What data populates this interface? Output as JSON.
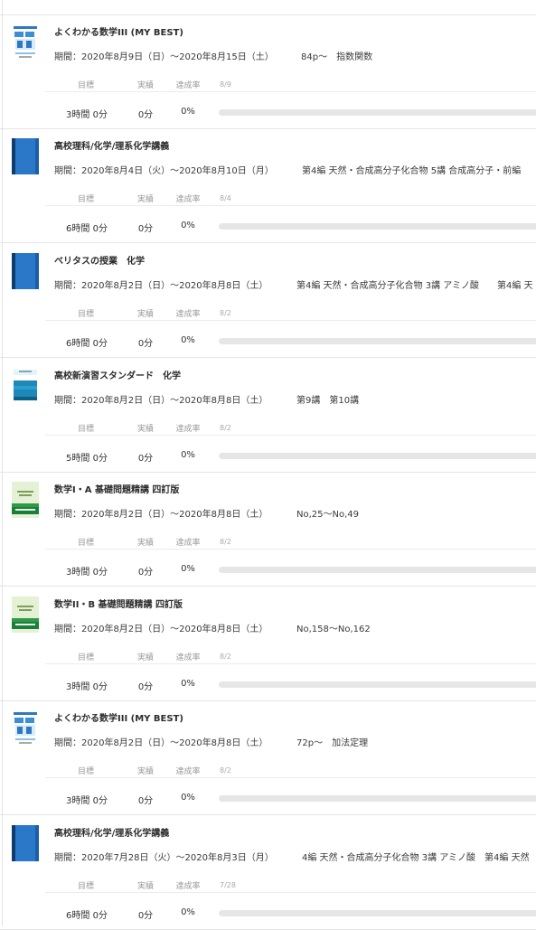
{
  "columns": {
    "target": "目標",
    "actual": "実績",
    "rate": "達成率"
  },
  "accent_colors": {
    "progress_track": "#e6e6e6",
    "progress_fill": "#6a9ef0"
  },
  "entries": [
    {
      "book_icon": "math-book-cover-icon",
      "title": "よくわかる数学III (MY BEST)",
      "period": "期間：2020年8月9日（日）〜2020年8月15日（土）",
      "scope": "84p〜　指数関数",
      "date_label": "8/9",
      "target_time": "3時間 0分",
      "actual_time": "0分",
      "rate": "0%",
      "progress": 0
    },
    {
      "book_icon": "blue-book-cover-icon",
      "title": "高校理科/化学/理系化学講義",
      "period": "期間：2020年8月4日（火）〜2020年8月10日（月）",
      "scope": "第4編 天然・合成高分子化合物 5講 合成高分子・前編",
      "date_label": "8/4",
      "target_time": "6時間 0分",
      "actual_time": "0分",
      "rate": "0%",
      "progress": 0
    },
    {
      "book_icon": "blue-book-cover-icon",
      "title": "ベリタスの授業　化学",
      "period": "期間：2020年8月2日（日）〜2020年8月8日（土）",
      "scope": "第4編 天然・合成高分子化合物 3講 アミノ酸　　第4編 天",
      "date_label": "8/2",
      "target_time": "6時間 0分",
      "actual_time": "0分",
      "rate": "0%",
      "progress": 0
    },
    {
      "book_icon": "chemistry-workbook-cover-icon",
      "title": "高校新演習スタンダード　化学",
      "period": "期間：2020年8月2日（日）〜2020年8月8日（土）",
      "scope": "第9講　第10講",
      "date_label": "8/2",
      "target_time": "5時間 0分",
      "actual_time": "0分",
      "rate": "0%",
      "progress": 0
    },
    {
      "book_icon": "green-book-cover-icon",
      "title": "数学I・A 基礎問題精講 四訂版",
      "period": "期間：2020年8月2日（日）〜2020年8月8日（土）",
      "scope": "No,25〜No,49",
      "date_label": "8/2",
      "target_time": "3時間 0分",
      "actual_time": "0分",
      "rate": "0%",
      "progress": 0
    },
    {
      "book_icon": "green-book-cover-icon",
      "title": "数学II・B 基礎問題精講 四訂版",
      "period": "期間：2020年8月2日（日）〜2020年8月8日（土）",
      "scope": "No,158〜No,162",
      "date_label": "8/2",
      "target_time": "3時間 0分",
      "actual_time": "0分",
      "rate": "0%",
      "progress": 0
    },
    {
      "book_icon": "math-book-cover-icon",
      "title": "よくわかる数学III (MY BEST)",
      "period": "期間：2020年8月2日（日）〜2020年8月8日（土）",
      "scope": "72p〜　加法定理",
      "date_label": "8/2",
      "target_time": "3時間 0分",
      "actual_time": "0分",
      "rate": "0%",
      "progress": 0
    },
    {
      "book_icon": "blue-book-cover-icon",
      "title": "高校理科/化学/理系化学講義",
      "period": "期間：2020年7月28日（火）〜2020年8月3日（月）",
      "scope": "4編 天然・合成高分子化合物 3講 アミノ酸　第4編 天然",
      "date_label": "7/28",
      "target_time": "6時間 0分",
      "actual_time": "0分",
      "rate": "0%",
      "progress": 0
    }
  ]
}
